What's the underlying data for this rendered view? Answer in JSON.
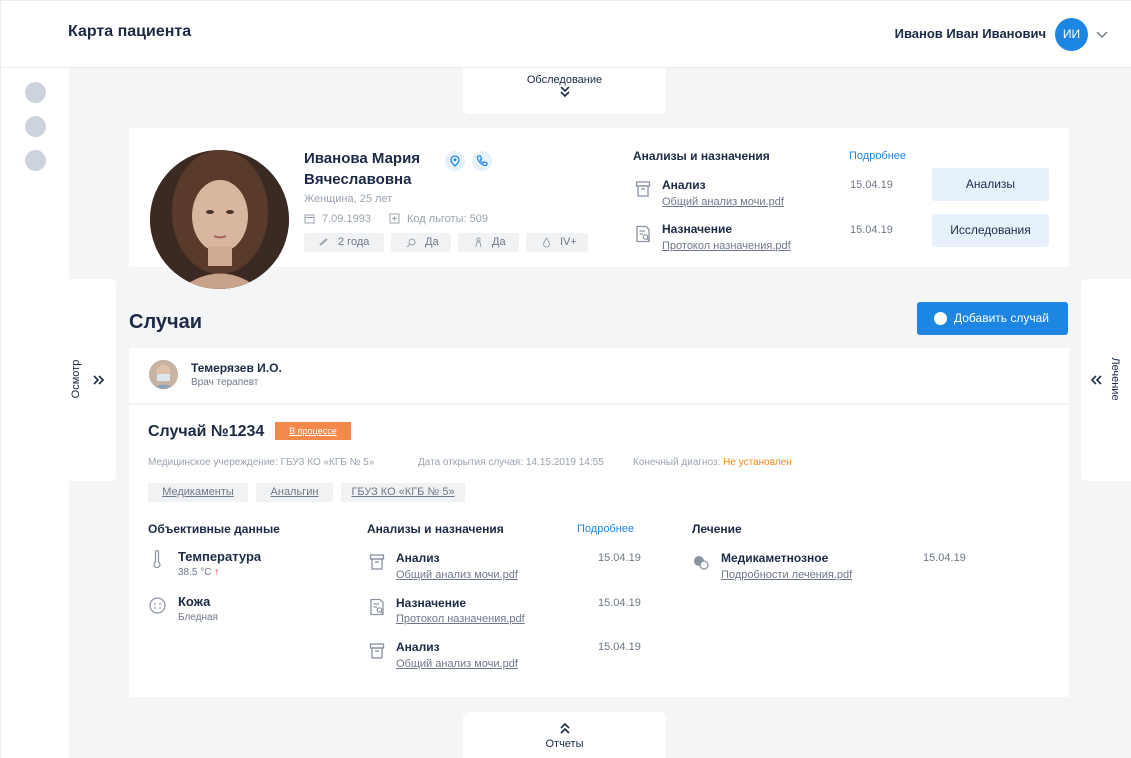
{
  "header": {
    "title": "Карта пациента",
    "user_name": "Иванов Иван Иванович",
    "user_initials": "ИИ"
  },
  "tabs": {
    "top": "Обследование",
    "bottom": "Отчеты",
    "left": "Осмотр",
    "right": "Лечение"
  },
  "patient": {
    "name": "Иванова Мария Вячеславовна",
    "gender_age": "Женщина, 25 лет",
    "birth_date": "7.09.1993",
    "benefit_code": "Код льготы: 509",
    "chips": [
      "2 года",
      "Да",
      "Да",
      "IV+"
    ]
  },
  "patient_docs": {
    "title": "Анализы и назначения",
    "more": "Подробнее",
    "items": [
      {
        "title": "Анализ",
        "link": "Общий анализ мочи.pdf",
        "date": "15.04.19",
        "button": "Анализы"
      },
      {
        "title": "Назначение",
        "link": "Протокол назначения.pdf",
        "date": "15.04.19",
        "button": "Исследования"
      }
    ]
  },
  "cases": {
    "title": "Случаи",
    "add_button": "Добавить случай",
    "doctor": {
      "name": "Темерязев И.О.",
      "role": "Врач терапевт"
    },
    "case": {
      "title": "Случай №1234",
      "status": "В процессе",
      "institution_label": "Медицинское учереждение:",
      "institution": "ГБУЗ КО «КГБ № 5»",
      "open_date_label": "Дата открытия случая:",
      "open_date": "14.15.2019 14:55",
      "diagnosis_label": "Конечный диагноз:",
      "diagnosis": "Не установлен",
      "tags": [
        "Медикаменты",
        "Анальгин",
        "ГБУЗ КО «КГБ № 5»"
      ],
      "objective": {
        "title": "Объективные данные",
        "items": [
          {
            "title": "Температура",
            "value": "38.5 °С",
            "trend": "↑"
          },
          {
            "title": "Кожа",
            "value": "Бледная"
          }
        ]
      },
      "analyses": {
        "title": "Анализы и назначения",
        "more": "Подробнее",
        "items": [
          {
            "title": "Анализ",
            "link": "Общий анализ мочи.pdf",
            "date": "15.04.19"
          },
          {
            "title": "Назначение",
            "link": "Протокол назначения.pdf",
            "date": "15.04.19"
          },
          {
            "title": "Анализ",
            "link": "Общий анализ мочи.pdf",
            "date": "15.04.19"
          }
        ]
      },
      "treatment": {
        "title": "Лечение",
        "items": [
          {
            "title": "Медикаметнозное",
            "link": "Подробности лечения.pdf",
            "date": "15.04.19"
          }
        ]
      }
    }
  },
  "colors": {
    "accent": "#1d86e3",
    "status": "#f4894b",
    "warning": "#f0871f",
    "background": "#f4f5f7"
  }
}
